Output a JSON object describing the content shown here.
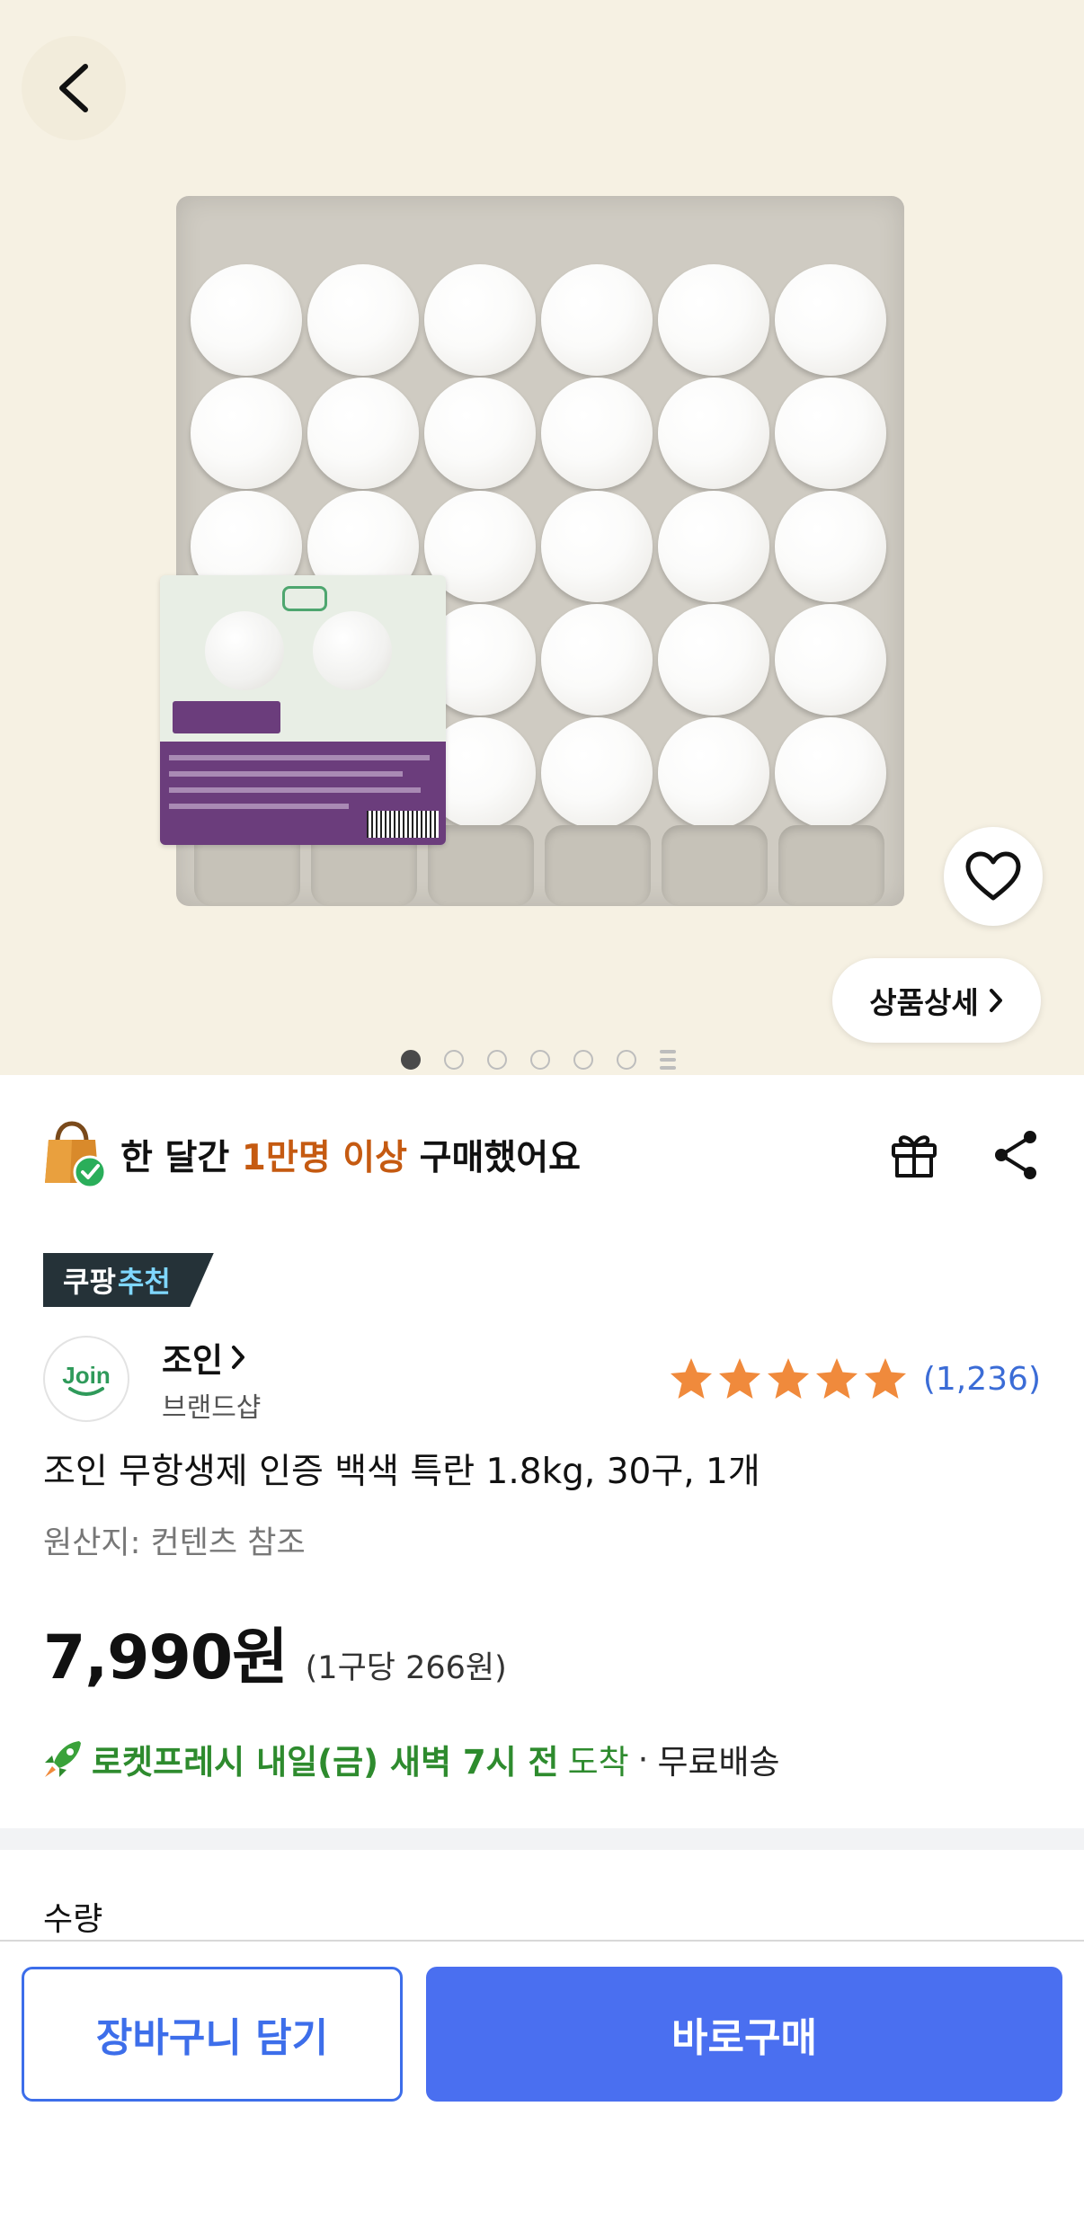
{
  "gallery": {
    "dots_total": 6,
    "active_dot": 1
  },
  "actions": {
    "detail_label": "상품상세"
  },
  "purchase": {
    "prefix": "한 달간 ",
    "highlight": "1만명 이상",
    "suffix": " 구매했어요"
  },
  "badge": {
    "part1": "쿠팡",
    "part2": "추천"
  },
  "brand": {
    "name": "조인",
    "sub": "브랜드샵",
    "logo_text": "Join"
  },
  "rating": {
    "stars": 5,
    "review_count": "(1,236)"
  },
  "product": {
    "title": "조인 무항생제 인증 백색 특란 1.8kg, 30구, 1개",
    "origin": "원산지: 컨텐츠 참조"
  },
  "price": {
    "amount": "7,990원",
    "unit": "(1구당 266원)"
  },
  "delivery": {
    "main": "로켓프레시 내일(금) 새벽 7시 전",
    "arrive": "도착",
    "sep": "·",
    "free": "무료배송"
  },
  "quantity": {
    "label": "수량"
  },
  "bottom": {
    "cart_label": "장바구니 담기",
    "buy_label": "바로구매"
  },
  "colors": {
    "accent_blue": "#4a6ff0",
    "highlight_orange": "#c55a11",
    "rocket_green": "#2e8b2e",
    "star": "#f08a3c",
    "review_link": "#3b6cd6"
  }
}
